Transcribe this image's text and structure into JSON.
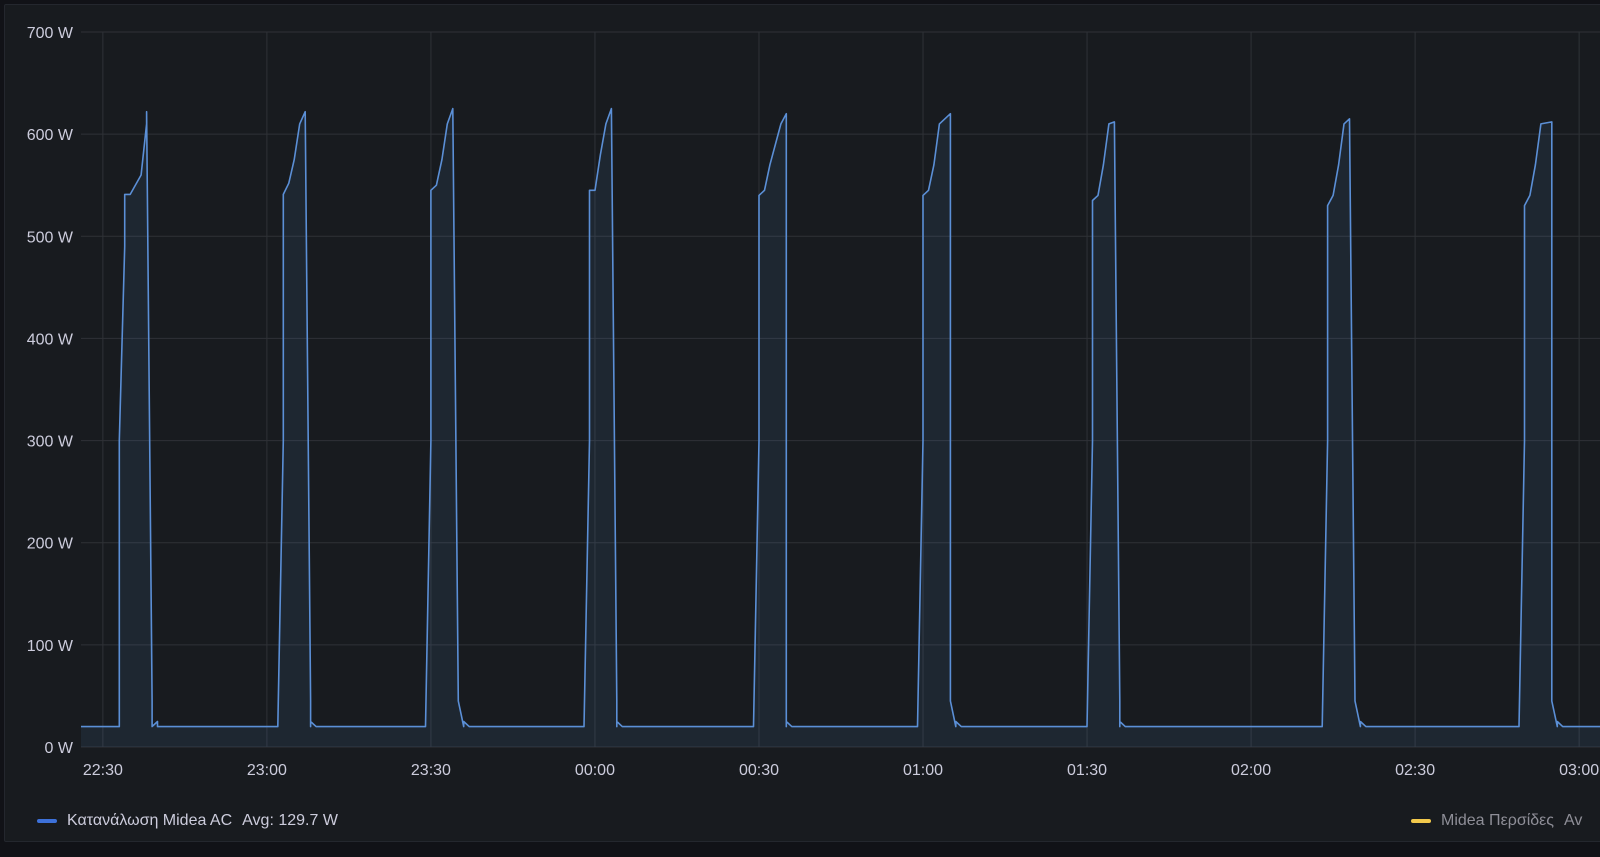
{
  "colors": {
    "background": "#181b1f",
    "grid": "#2f3237",
    "text": "#ccccdc",
    "series_ac": "#5b8fd6",
    "series_blinds": "#f2c94c"
  },
  "legend": [
    {
      "name": "Κατανάλωση Midea AC",
      "stat": "Avg: 129.7 W",
      "color": "#3d71d9"
    },
    {
      "name": "Midea Περσίδες",
      "stat": "Av",
      "color": "#f2c94c"
    }
  ],
  "chart_data": {
    "type": "area",
    "title": "",
    "xlabel": "",
    "ylabel": "",
    "ylim": [
      0,
      700
    ],
    "y_ticks": [
      "0 W",
      "100 W",
      "200 W",
      "300 W",
      "400 W",
      "500 W",
      "600 W",
      "700 W"
    ],
    "x_ticks": [
      "22:30",
      "23:00",
      "23:30",
      "00:00",
      "00:30",
      "01:00",
      "01:30",
      "02:00",
      "02:30",
      "03:00"
    ],
    "x_range": [
      "22:26",
      "03:04"
    ],
    "grid": true,
    "legend_position": "bottom",
    "series": [
      {
        "name": "Κατανάλωση Midea AC",
        "x": [
          "22:26",
          "22:33",
          "22:33",
          "22:34",
          "22:34",
          "22:35",
          "22:37",
          "22:38",
          "22:38",
          "22:39",
          "22:39",
          "22:40",
          "22:40",
          "22:41",
          "22:41",
          "23:02",
          "23:03",
          "23:03",
          "23:04",
          "23:05",
          "23:06",
          "23:07",
          "23:08",
          "23:08",
          "23:08",
          "23:09",
          "23:09",
          "23:29",
          "23:30",
          "23:30",
          "23:31",
          "23:32",
          "23:33",
          "23:34",
          "23:35",
          "23:36",
          "23:36",
          "23:37",
          "23:37",
          "23:58",
          "23:59",
          "23:59",
          "00:00",
          "00:01",
          "00:02",
          "00:03",
          "00:04",
          "00:04",
          "00:04",
          "00:05",
          "00:05",
          "00:29",
          "00:30",
          "00:30",
          "00:31",
          "00:32",
          "00:34",
          "00:35",
          "00:35",
          "00:35",
          "00:35",
          "00:36",
          "00:36",
          "00:59",
          "01:00",
          "01:00",
          "01:01",
          "01:02",
          "01:03",
          "01:05",
          "01:05",
          "01:06",
          "01:06",
          "01:07",
          "01:07",
          "01:30",
          "01:31",
          "01:31",
          "01:32",
          "01:33",
          "01:34",
          "01:35",
          "01:36",
          "01:36",
          "01:36",
          "01:37",
          "01:37",
          "02:13",
          "02:14",
          "02:14",
          "02:15",
          "02:16",
          "02:17",
          "02:18",
          "02:19",
          "02:20",
          "02:20",
          "02:21",
          "02:21",
          "02:49",
          "02:50",
          "02:50",
          "02:51",
          "02:52",
          "02:53",
          "02:55",
          "02:55",
          "02:56",
          "02:56",
          "02:57",
          "03:04"
        ],
        "values": [
          20,
          20,
          300,
          490,
          541,
          541,
          560,
          610,
          622,
          45,
          20,
          25,
          20,
          20,
          20,
          20,
          300,
          541,
          552,
          575,
          610,
          622,
          45,
          20,
          25,
          20,
          20,
          20,
          300,
          545,
          550,
          575,
          610,
          625,
          45,
          20,
          25,
          20,
          20,
          20,
          300,
          545,
          545,
          580,
          610,
          625,
          45,
          20,
          25,
          20,
          20,
          20,
          300,
          540,
          545,
          570,
          610,
          620,
          45,
          20,
          25,
          20,
          20,
          20,
          300,
          540,
          545,
          570,
          610,
          620,
          45,
          20,
          25,
          20,
          20,
          20,
          300,
          535,
          540,
          570,
          610,
          612,
          45,
          20,
          25,
          20,
          20,
          20,
          300,
          530,
          540,
          570,
          610,
          615,
          45,
          20,
          25,
          20,
          20,
          20,
          300,
          530,
          540,
          570,
          610,
          612,
          45,
          20,
          25,
          20,
          20
        ]
      }
    ]
  }
}
